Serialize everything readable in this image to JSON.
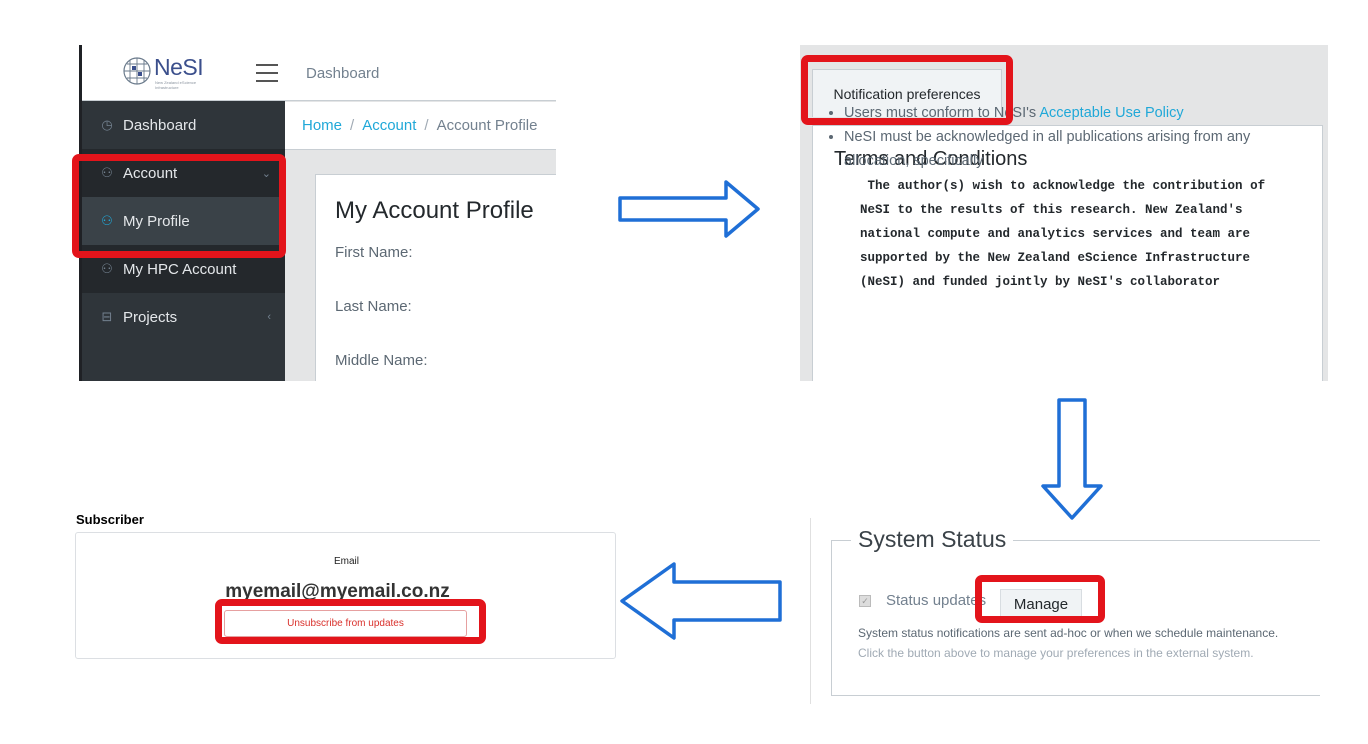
{
  "panel1": {
    "logo_text": "NeSI",
    "logo_subtext": "New Zealand eScience Infrastructure",
    "topnav_label": "Dashboard",
    "sidebar": {
      "items": [
        {
          "label": "Dashboard",
          "icon": "speedometer-icon"
        },
        {
          "label": "Account",
          "icon": "user-icon"
        },
        {
          "label": "My Profile",
          "icon": "user-icon"
        },
        {
          "label": "My HPC Account",
          "icon": "user-icon"
        },
        {
          "label": "Projects",
          "icon": "briefcase-icon"
        }
      ]
    },
    "breadcrumb": {
      "home": "Home",
      "sep": "/",
      "account": "Account",
      "current": "Account Profile"
    },
    "card": {
      "title": "My Account Profile",
      "fields": [
        "First Name:",
        "Last Name:",
        "Middle Name:"
      ]
    }
  },
  "panel2": {
    "tab_label": "Notification preferences",
    "terms_title": "Terms and Conditions",
    "bullet1_prefix": "Users must conform to NeSI's ",
    "bullet1_link": "Acceptable Use Policy",
    "bullet2": "NeSI must be acknowledged in all publications arising from any allocation, specifically",
    "acknowledgement": " The author(s) wish to acknowledge the contribution of\nNeSI to the results of this research. New Zealand's\nnational compute and analytics services and team are\nsupported by the New Zealand eScience Infrastructure\n(NeSI) and funded jointly by NeSI's collaborator"
  },
  "panel3": {
    "title": "Subscriber",
    "email_label": "Email",
    "email_value": "myemail@myemail.co.nz",
    "unsubscribe_label": "Unsubscribe from updates"
  },
  "panel4": {
    "legend": "System Status",
    "checkbox_label": "Status updates",
    "manage_label": "Manage",
    "note1": "System status notifications are sent ad-hoc or when we schedule maintenance.",
    "note2": "Click the button above to manage your preferences in the external system."
  },
  "colors": {
    "highlight": "#e3141b",
    "arrow": "#1f6fd6",
    "link": "#20a8d8",
    "sidebar": "#2f353a"
  }
}
